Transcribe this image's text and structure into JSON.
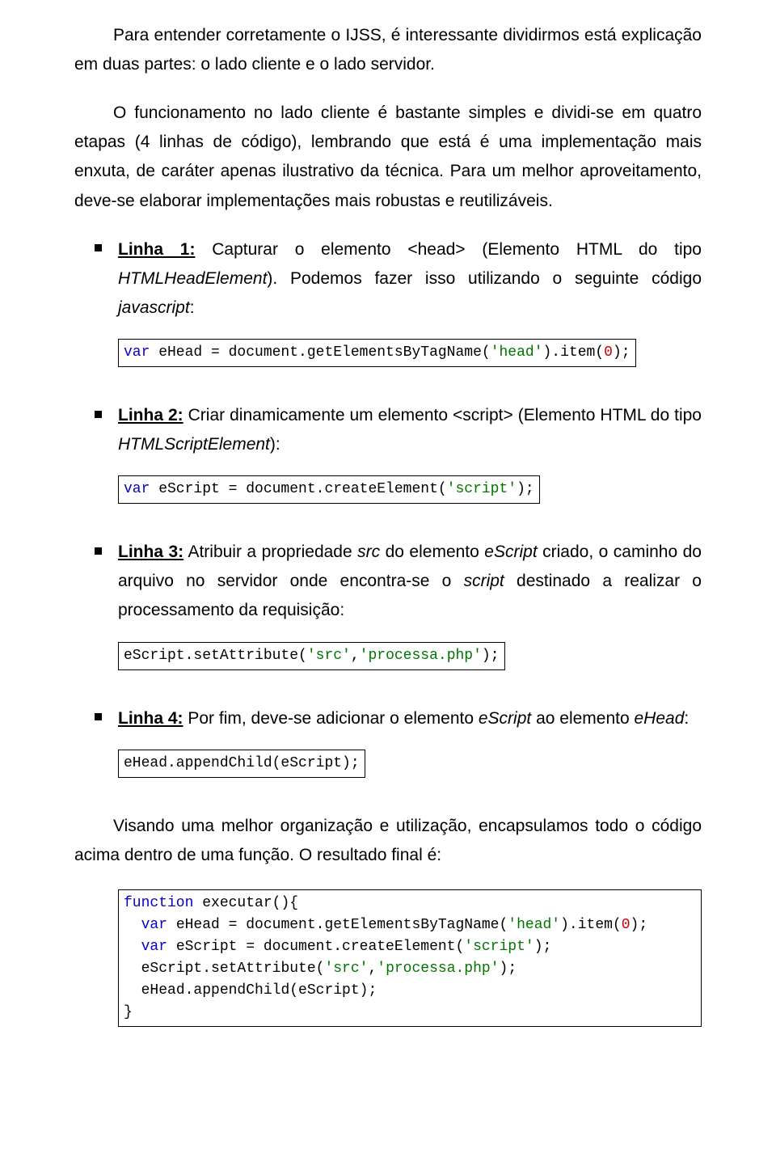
{
  "intro1": "Para entender corretamente o IJSS, é interessante dividirmos está explicação em duas partes: o lado cliente e o lado servidor.",
  "intro2": "O funcionamento no lado cliente é bastante simples e dividi-se em quatro etapas (4 linhas de código), lembrando que está é uma implementação mais enxuta, de caráter apenas ilustrativo da técnica. Para um melhor aproveitamento, deve-se elaborar implementações mais robustas e reutilizáveis.",
  "linha1": {
    "label": "Linha 1:",
    "text_a": " Capturar o elemento <head> (Elemento HTML do tipo ",
    "ital_a": "HTMLHeadElement",
    "text_b": "). Podemos fazer isso utilizando o seguinte código ",
    "ital_b": "javascript",
    "text_c": ":"
  },
  "linha2": {
    "label": "Linha 2:",
    "text_a": " Criar dinamicamente um elemento <script> (Elemento HTML do tipo ",
    "ital_a": "HTMLScriptElement",
    "text_b": "):"
  },
  "linha3": {
    "label": "Linha 3:",
    "text_a": " Atribuir a propriedade ",
    "ital_a": "src",
    "text_b": " do elemento ",
    "ital_b": "eScript",
    "text_c": " criado, o caminho do arquivo no servidor onde encontra-se o ",
    "ital_c": "script",
    "text_d": " destinado a realizar o processamento da requisição:"
  },
  "linha4": {
    "label": "Linha 4:",
    "text_a": " Por fim, deve-se adicionar o elemento ",
    "ital_a": "eScript",
    "text_b": " ao elemento ",
    "ital_b": "eHead",
    "text_c": ":"
  },
  "closing": "Visando uma melhor organização e utilização, encapsulamos todo o código acima dentro de uma função. O resultado final é:",
  "code": {
    "kw_var": "var",
    "kw_func": "function",
    "num_0": "0",
    "str_head": "'head'",
    "str_script": "'script'",
    "str_src": "'src'",
    "str_proc": "'processa.php'",
    "c1_a": " eHead = document.getElementsByTagName(",
    "c1_b": ").item(",
    "c1_c": ");",
    "c2_a": " eScript = document.createElement(",
    "c2_b": ");",
    "c3_a": "eScript.setAttribute(",
    "c3_b": ",",
    "c3_c": ");",
    "c4_a": "eHead.appendChild(eScript);",
    "fn_sig": " executar(){",
    "indent": "  ",
    "close": "}"
  }
}
